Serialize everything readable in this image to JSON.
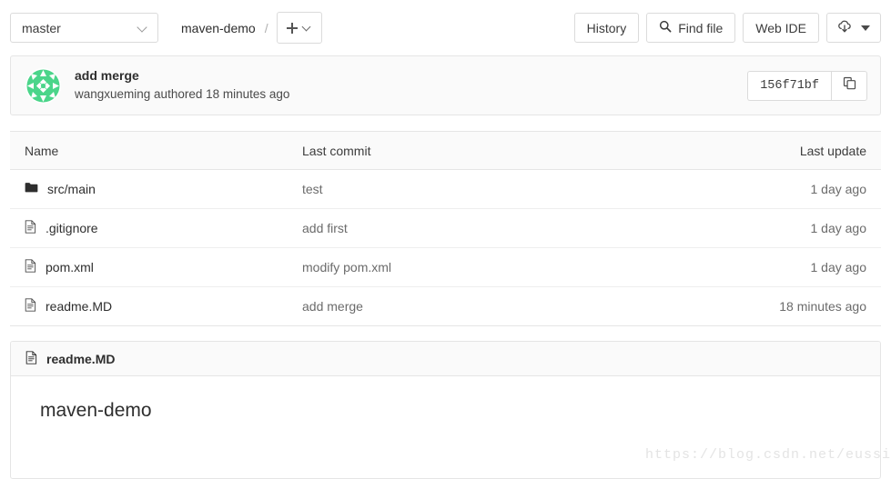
{
  "toolbar": {
    "branch": "master",
    "project": "maven-demo",
    "separator": "/",
    "add_button_icon": "plus-icon",
    "history_label": "History",
    "find_file_label": "Find file",
    "web_ide_label": "Web IDE",
    "download_icon": "cloud-download-icon"
  },
  "commit": {
    "avatar_icon": "user-identicon-avatar",
    "title": "add merge",
    "meta": "wangxueming authored 18 minutes ago",
    "sha": "156f71bf",
    "copy_icon": "copy-icon"
  },
  "file_table": {
    "headers": {
      "name": "Name",
      "last_commit": "Last commit",
      "last_update": "Last update"
    },
    "rows": [
      {
        "icon": "folder-icon",
        "name": "src/main",
        "last_commit": "test",
        "last_update": "1 day ago"
      },
      {
        "icon": "file-icon",
        "name": ".gitignore",
        "last_commit": "add first",
        "last_update": "1 day ago"
      },
      {
        "icon": "file-icon",
        "name": "pom.xml",
        "last_commit": "modify pom.xml",
        "last_update": "1 day ago"
      },
      {
        "icon": "file-icon",
        "name": "readme.MD",
        "last_commit": "add merge",
        "last_update": "18 minutes ago"
      }
    ]
  },
  "readme": {
    "icon": "file-icon",
    "filename": "readme.MD",
    "heading": "maven-demo"
  },
  "watermark": "https://blog.csdn.net/eussi",
  "colors": {
    "panel_bg": "#fafafa",
    "border": "#e5e5e5",
    "text": "#2e2e2e",
    "muted": "#6b6b6b",
    "avatar_green": "#4bd58a"
  }
}
